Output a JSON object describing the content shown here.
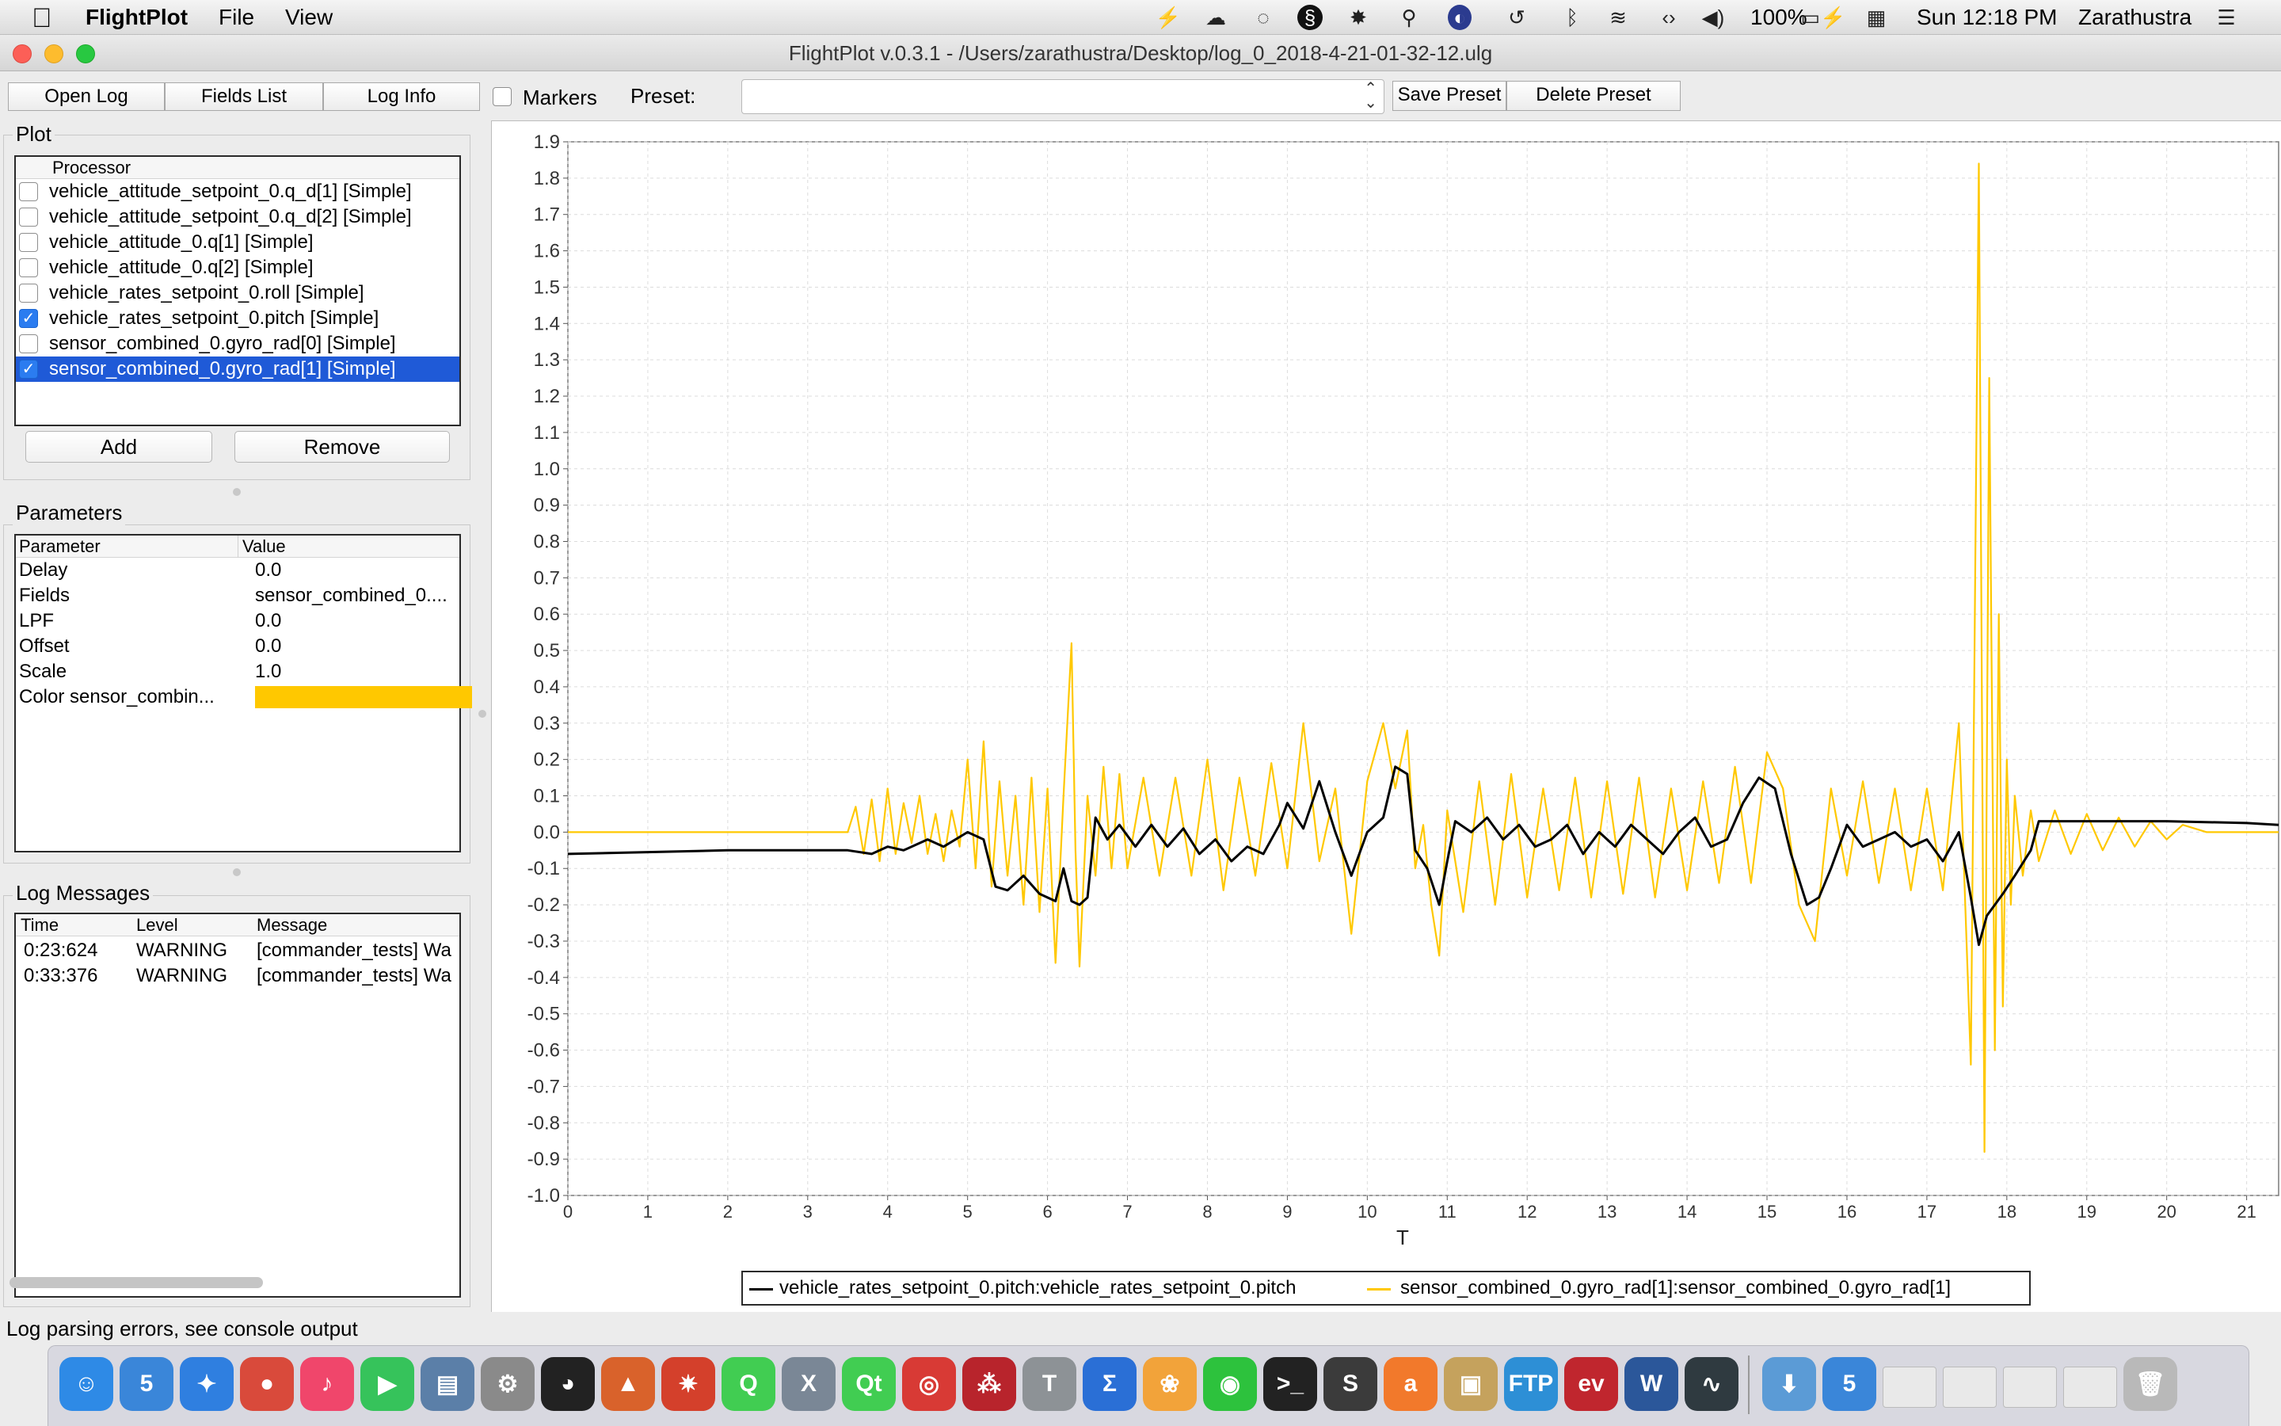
{
  "menubar": {
    "app_name": "FlightPlot",
    "menus": [
      "File",
      "View"
    ],
    "battery": "100%",
    "clock": "Sun 12:18 PM",
    "user": "Zarathustra"
  },
  "window": {
    "title": "FlightPlot v.0.3.1 - /Users/zarathustra/Desktop/log_0_2018-4-21-01-32-12.ulg"
  },
  "toolbar": {
    "open_log": "Open Log",
    "fields_list": "Fields List",
    "log_info": "Log Info",
    "markers_label": "Markers",
    "markers_checked": false,
    "preset_label": "Preset:",
    "preset_value": "",
    "save_preset": "Save Preset",
    "delete_preset": "Delete Preset"
  },
  "plot_panel": {
    "title": "Plot",
    "column_header": "Processor",
    "processors": [
      {
        "label": "vehicle_attitude_setpoint_0.q_d[1] [Simple]",
        "checked": false,
        "selected": false
      },
      {
        "label": "vehicle_attitude_setpoint_0.q_d[2] [Simple]",
        "checked": false,
        "selected": false
      },
      {
        "label": "vehicle_attitude_0.q[1] [Simple]",
        "checked": false,
        "selected": false
      },
      {
        "label": "vehicle_attitude_0.q[2] [Simple]",
        "checked": false,
        "selected": false
      },
      {
        "label": "vehicle_rates_setpoint_0.roll [Simple]",
        "checked": false,
        "selected": false
      },
      {
        "label": "vehicle_rates_setpoint_0.pitch [Simple]",
        "checked": true,
        "selected": false
      },
      {
        "label": "sensor_combined_0.gyro_rad[0] [Simple]",
        "checked": false,
        "selected": false
      },
      {
        "label": "sensor_combined_0.gyro_rad[1] [Simple]",
        "checked": true,
        "selected": true
      }
    ],
    "add_button": "Add",
    "remove_button": "Remove"
  },
  "parameters_panel": {
    "title": "Parameters",
    "headers": [
      "Parameter",
      "Value"
    ],
    "rows": [
      {
        "name": "Delay",
        "value": "0.0"
      },
      {
        "name": "Fields",
        "value": "sensor_combined_0...."
      },
      {
        "name": "LPF",
        "value": "0.0"
      },
      {
        "name": "Offset",
        "value": "0.0"
      },
      {
        "name": "Scale",
        "value": "1.0"
      },
      {
        "name": "Color sensor_combin...",
        "value": "",
        "color": "#ffc800"
      }
    ]
  },
  "log_messages_panel": {
    "title": "Log Messages",
    "headers": [
      "Time",
      "Level",
      "Message"
    ],
    "rows": [
      {
        "time": "0:23:624",
        "level": "WARNING",
        "message": "[commander_tests] Wa"
      },
      {
        "time": "0:33:376",
        "level": "WARNING",
        "message": "[commander_tests] Wa"
      }
    ]
  },
  "status_bar": {
    "text": "Log parsing errors, see console output"
  },
  "chart_data": {
    "type": "line",
    "xlabel": "T",
    "ylabel": "",
    "xlim": [
      0,
      21.4
    ],
    "ylim": [
      -1.0,
      1.9
    ],
    "x_ticks": [
      0,
      1,
      2,
      3,
      4,
      5,
      6,
      7,
      8,
      9,
      10,
      11,
      12,
      13,
      14,
      15,
      16,
      17,
      18,
      19,
      20,
      21
    ],
    "y_ticks": [
      -1.0,
      -0.9,
      -0.8,
      -0.7,
      -0.6,
      -0.5,
      -0.4,
      -0.3,
      -0.2,
      -0.1,
      0.0,
      0.1,
      0.2,
      0.3,
      0.4,
      0.5,
      0.6,
      0.7,
      0.8,
      0.9,
      1.0,
      1.1,
      1.2,
      1.3,
      1.4,
      1.5,
      1.6,
      1.7,
      1.8,
      1.9
    ],
    "grid": true,
    "legend_position": "bottom-center",
    "series": [
      {
        "name": "vehicle_rates_setpoint_0.pitch:vehicle_rates_setpoint_0.pitch",
        "color": "#000000",
        "x": [
          0,
          1,
          2,
          3,
          3.5,
          3.8,
          4.0,
          4.2,
          4.5,
          4.7,
          5.0,
          5.2,
          5.35,
          5.5,
          5.7,
          5.9,
          6.0,
          6.1,
          6.2,
          6.3,
          6.4,
          6.5,
          6.6,
          6.75,
          6.9,
          7.1,
          7.3,
          7.5,
          7.7,
          7.9,
          8.1,
          8.3,
          8.5,
          8.7,
          8.9,
          9.0,
          9.2,
          9.4,
          9.6,
          9.8,
          10.0,
          10.2,
          10.35,
          10.5,
          10.6,
          10.75,
          10.9,
          11.0,
          11.1,
          11.3,
          11.5,
          11.7,
          11.9,
          12.1,
          12.3,
          12.5,
          12.7,
          12.9,
          13.1,
          13.3,
          13.5,
          13.7,
          13.9,
          14.1,
          14.3,
          14.5,
          14.7,
          14.9,
          15.1,
          15.3,
          15.5,
          15.65,
          15.8,
          16.0,
          16.2,
          16.4,
          16.6,
          16.8,
          17.0,
          17.2,
          17.4,
          17.55,
          17.65,
          17.75,
          17.85,
          17.95,
          18.1,
          18.3,
          18.4,
          18.6,
          19.0,
          20.0,
          21.0,
          21.4
        ],
        "y": [
          -0.06,
          -0.055,
          -0.05,
          -0.05,
          -0.05,
          -0.06,
          -0.04,
          -0.05,
          -0.02,
          -0.04,
          0.0,
          -0.02,
          -0.15,
          -0.16,
          -0.12,
          -0.17,
          -0.18,
          -0.19,
          -0.1,
          -0.19,
          -0.2,
          -0.18,
          0.04,
          -0.02,
          0.02,
          -0.04,
          0.02,
          -0.04,
          0.01,
          -0.06,
          -0.02,
          -0.08,
          -0.04,
          -0.06,
          0.02,
          0.08,
          0.01,
          0.14,
          0.0,
          -0.12,
          0.0,
          0.04,
          0.18,
          0.16,
          -0.05,
          -0.1,
          -0.2,
          -0.08,
          0.03,
          0.0,
          0.04,
          -0.02,
          0.02,
          -0.04,
          -0.02,
          0.02,
          -0.06,
          0.0,
          -0.04,
          0.02,
          -0.02,
          -0.06,
          0.0,
          0.04,
          -0.04,
          -0.02,
          0.08,
          0.15,
          0.12,
          -0.06,
          -0.2,
          -0.18,
          -0.1,
          0.02,
          -0.04,
          -0.02,
          0.0,
          -0.04,
          -0.02,
          -0.08,
          0.0,
          -0.18,
          -0.31,
          -0.23,
          -0.2,
          -0.17,
          -0.12,
          -0.05,
          0.03,
          0.03,
          0.03,
          0.03,
          0.025,
          0.02
        ]
      },
      {
        "name": "sensor_combined_0.gyro_rad[1]:sensor_combined_0.gyro_rad[1]",
        "color": "#ffc800",
        "x": [
          0,
          0.5,
          1.0,
          1.5,
          2.0,
          2.5,
          3.0,
          3.5,
          3.6,
          3.7,
          3.8,
          3.9,
          4.0,
          4.1,
          4.2,
          4.3,
          4.4,
          4.5,
          4.6,
          4.7,
          4.8,
          4.9,
          5.0,
          5.1,
          5.2,
          5.3,
          5.4,
          5.5,
          5.6,
          5.7,
          5.8,
          5.9,
          6.0,
          6.1,
          6.2,
          6.3,
          6.35,
          6.4,
          6.5,
          6.6,
          6.7,
          6.8,
          6.9,
          7.0,
          7.2,
          7.4,
          7.6,
          7.8,
          8.0,
          8.2,
          8.4,
          8.6,
          8.8,
          9.0,
          9.2,
          9.4,
          9.6,
          9.8,
          10.0,
          10.2,
          10.35,
          10.5,
          10.6,
          10.7,
          10.8,
          10.9,
          11.0,
          11.2,
          11.4,
          11.6,
          11.8,
          12.0,
          12.2,
          12.4,
          12.6,
          12.8,
          13.0,
          13.2,
          13.4,
          13.6,
          13.8,
          14.0,
          14.2,
          14.4,
          14.6,
          14.8,
          15.0,
          15.2,
          15.4,
          15.6,
          15.8,
          16.0,
          16.2,
          16.4,
          16.6,
          16.8,
          17.0,
          17.2,
          17.4,
          17.55,
          17.65,
          17.72,
          17.78,
          17.85,
          17.9,
          17.95,
          18.0,
          18.05,
          18.1,
          18.2,
          18.3,
          18.4,
          18.6,
          18.8,
          19.0,
          19.2,
          19.4,
          19.6,
          19.8,
          20.0,
          20.2,
          20.5,
          21.0,
          21.4
        ],
        "y": [
          0.0,
          0.0,
          0.0,
          0.0,
          0.0,
          0.0,
          0.0,
          0.0,
          0.07,
          -0.06,
          0.09,
          -0.08,
          0.12,
          -0.06,
          0.08,
          -0.03,
          0.1,
          -0.06,
          0.05,
          -0.08,
          0.06,
          -0.04,
          0.2,
          -0.1,
          0.25,
          -0.15,
          0.14,
          -0.12,
          0.1,
          -0.2,
          0.15,
          -0.22,
          0.12,
          -0.36,
          0.1,
          0.52,
          -0.05,
          -0.37,
          0.1,
          -0.12,
          0.18,
          -0.1,
          0.16,
          -0.1,
          0.15,
          -0.12,
          0.15,
          -0.12,
          0.2,
          -0.16,
          0.15,
          -0.12,
          0.19,
          -0.1,
          0.3,
          -0.08,
          0.12,
          -0.28,
          0.14,
          0.3,
          0.12,
          0.28,
          -0.1,
          0.02,
          -0.2,
          -0.34,
          0.06,
          -0.22,
          0.14,
          -0.2,
          0.16,
          -0.18,
          0.12,
          -0.16,
          0.15,
          -0.18,
          0.14,
          -0.17,
          0.15,
          -0.18,
          0.12,
          -0.16,
          0.14,
          -0.14,
          0.18,
          -0.14,
          0.22,
          0.12,
          -0.2,
          -0.3,
          0.12,
          -0.12,
          0.14,
          -0.14,
          0.12,
          -0.16,
          0.12,
          -0.16,
          0.3,
          -0.64,
          1.84,
          -0.88,
          1.25,
          -0.6,
          0.6,
          -0.48,
          0.2,
          -0.2,
          0.1,
          -0.12,
          0.06,
          -0.08,
          0.06,
          -0.06,
          0.05,
          -0.05,
          0.04,
          -0.04,
          0.03,
          -0.02,
          0.02,
          0.0,
          0.0,
          0.0
        ]
      }
    ]
  },
  "dock": {
    "icons": [
      {
        "name": "finder-icon",
        "color": "#2e8ae6",
        "glyph": "☺"
      },
      {
        "name": "html5-icon",
        "color": "#3a86d9",
        "glyph": "5"
      },
      {
        "name": "safari-icon",
        "color": "#2f7fe0",
        "glyph": "✦"
      },
      {
        "name": "chrome-icon",
        "color": "#d94a3b",
        "glyph": "●"
      },
      {
        "name": "music-icon",
        "color": "#f0466b",
        "glyph": "♪"
      },
      {
        "name": "facetime-icon",
        "color": "#36c35b",
        "glyph": "▶"
      },
      {
        "name": "screen-icon",
        "color": "#5b7fa8",
        "glyph": "▤"
      },
      {
        "name": "settings-icon",
        "color": "#8a8a8a",
        "glyph": "⚙"
      },
      {
        "name": "qq-icon",
        "color": "#222222",
        "glyph": "◕"
      },
      {
        "name": "matlab-icon",
        "color": "#d9622b",
        "glyph": "▲"
      },
      {
        "name": "mathematica-icon",
        "color": "#d4402b",
        "glyph": "✷"
      },
      {
        "name": "qt-creator-icon",
        "color": "#41cd52",
        "glyph": "Q"
      },
      {
        "name": "xcode-icon",
        "color": "#7a8796",
        "glyph": "X"
      },
      {
        "name": "qt-icon",
        "color": "#41cd52",
        "glyph": "Qt"
      },
      {
        "name": "netease-music-icon",
        "color": "#d83a35",
        "glyph": "◎"
      },
      {
        "name": "mendeley-icon",
        "color": "#b8242c",
        "glyph": "⁂"
      },
      {
        "name": "tex-icon",
        "color": "#8d9296",
        "glyph": "T"
      },
      {
        "name": "sigma-icon",
        "color": "#2a6fd6",
        "glyph": "Σ"
      },
      {
        "name": "photos-icon",
        "color": "#f2a33a",
        "glyph": "❀"
      },
      {
        "name": "wechat-icon",
        "color": "#2dc23d",
        "glyph": "◉"
      },
      {
        "name": "terminal-icon",
        "color": "#222222",
        "glyph": ">_"
      },
      {
        "name": "sublime-icon",
        "color": "#3b3b3b",
        "glyph": "S"
      },
      {
        "name": "avast-icon",
        "color": "#f2792b",
        "glyph": "a"
      },
      {
        "name": "transmit-icon",
        "color": "#c5a25d",
        "glyph": "▣"
      },
      {
        "name": "ftp-icon",
        "color": "#2d8fd6",
        "glyph": "FTP"
      },
      {
        "name": "eviews-icon",
        "color": "#c0262e",
        "glyph": "ev"
      },
      {
        "name": "word-icon",
        "color": "#2b579a",
        "glyph": "W"
      },
      {
        "name": "activity-monitor-icon",
        "color": "#2f3a40",
        "glyph": "∿"
      },
      {
        "name": "downloads-icon",
        "color": "#5b9bd6",
        "glyph": "⬇"
      },
      {
        "name": "html5-window-icon",
        "color": "#3a86d9",
        "glyph": "5"
      },
      {
        "name": "window-thumb-1-icon",
        "color": "#e9e9e9",
        "glyph": ""
      },
      {
        "name": "window-thumb-2-icon",
        "color": "#e9e9e9",
        "glyph": ""
      },
      {
        "name": "window-thumb-3-icon",
        "color": "#e9e9e9",
        "glyph": ""
      },
      {
        "name": "window-thumb-4-icon",
        "color": "#e9e9e9",
        "glyph": ""
      },
      {
        "name": "trash-icon",
        "color": "#b9b9b9",
        "glyph": "🗑"
      }
    ]
  }
}
